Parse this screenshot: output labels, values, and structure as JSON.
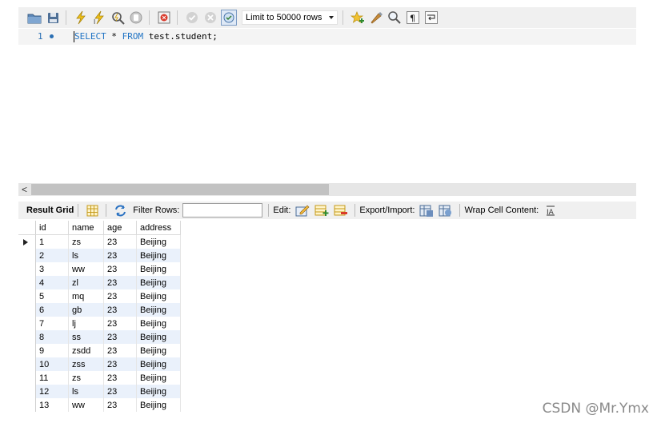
{
  "toolbar": {
    "buttons": [
      "open-folder-icon",
      "save-icon",
      "execute-icon",
      "execute-current-icon",
      "explain-icon",
      "stop-icon",
      "toggle-error-icon",
      "commit-icon",
      "rollback-icon",
      "autocommit-icon"
    ],
    "limit_label": "Limit to 50000 rows",
    "extra_buttons": [
      "bookmark-star-icon",
      "beautify-icon",
      "find-icon",
      "invisible-chars-icon",
      "wrap-icon"
    ]
  },
  "editor": {
    "line_number": "1",
    "keyword1": "SELECT",
    "middle": " * ",
    "keyword2": "FROM",
    "rest": " test.student;"
  },
  "result_toolbar": {
    "grid_label": "Result Grid",
    "filter_label": "Filter Rows:",
    "filter_value": "",
    "edit_label": "Edit:",
    "export_label": "Export/Import:",
    "wrap_label": "Wrap Cell Content:"
  },
  "table": {
    "columns": [
      "id",
      "name",
      "age",
      "address"
    ],
    "rows": [
      [
        "1",
        "zs",
        "23",
        "Beijing"
      ],
      [
        "2",
        "ls",
        "23",
        "Beijing"
      ],
      [
        "3",
        "ww",
        "23",
        "Beijing"
      ],
      [
        "4",
        "zl",
        "23",
        "Beijing"
      ],
      [
        "5",
        "mq",
        "23",
        "Beijing"
      ],
      [
        "6",
        "gb",
        "23",
        "Beijing"
      ],
      [
        "7",
        "lj",
        "23",
        "Beijing"
      ],
      [
        "8",
        "ss",
        "23",
        "Beijing"
      ],
      [
        "9",
        "zsdd",
        "23",
        "Beijing"
      ],
      [
        "10",
        "zss",
        "23",
        "Beijing"
      ],
      [
        "11",
        "zs",
        "23",
        "Beijing"
      ],
      [
        "12",
        "ls",
        "23",
        "Beijing"
      ],
      [
        "13",
        "ww",
        "23",
        "Beijing"
      ]
    ]
  },
  "watermark": "CSDN @Mr.Ymx",
  "colors": {
    "keyword": "#1f73c4",
    "alt_row": "#eaf1fb",
    "toolbar_bg": "#f0f0f0"
  }
}
